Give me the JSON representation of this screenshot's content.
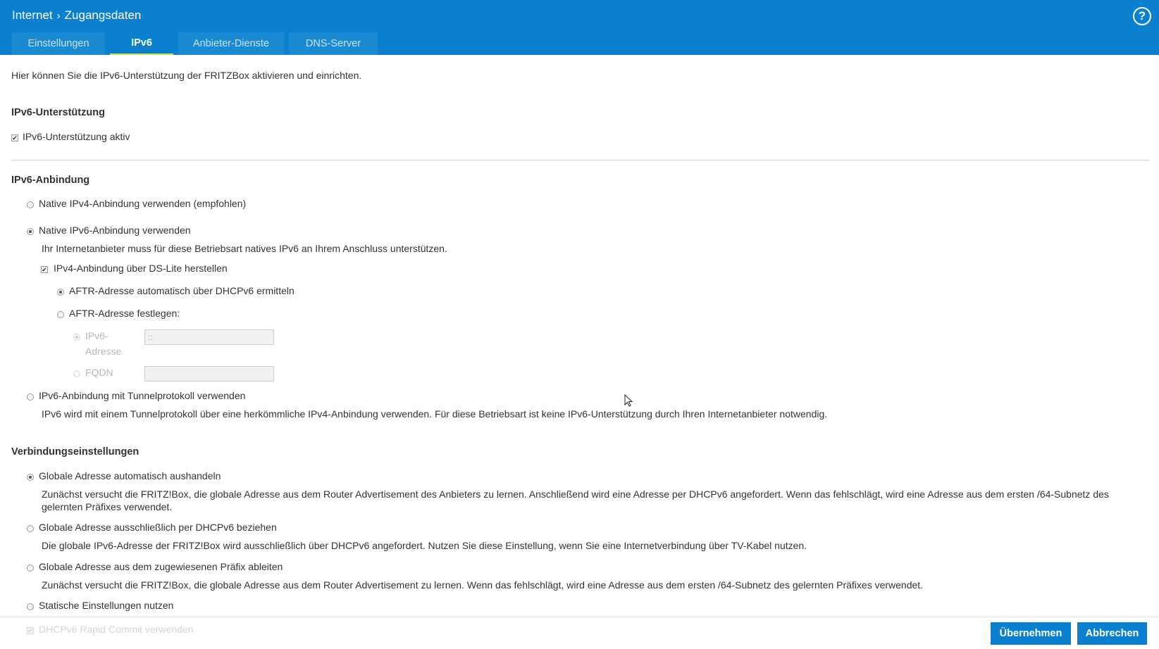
{
  "header": {
    "breadcrumb": [
      "Internet",
      "Zugangsdaten"
    ],
    "help_label": "?"
  },
  "tabs": [
    {
      "label": "Einstellungen",
      "active": false
    },
    {
      "label": "IPv6",
      "active": true
    },
    {
      "label": "Anbieter-Dienste",
      "active": false
    },
    {
      "label": "DNS-Server",
      "active": false
    }
  ],
  "intro": "Hier können Sie die IPv6-Unterstützung der FRITZBox aktivieren und einrichten.",
  "ipv6_support": {
    "heading": "IPv6-Unterstützung",
    "checkbox_label": "IPv6-Unterstützung aktiv",
    "checked": true
  },
  "binding": {
    "heading": "IPv6-Anbindung",
    "native_ipv4_label": "Native IPv4-Anbindung verwenden (empfohlen)",
    "native_ipv6_label": "Native IPv6-Anbindung verwenden",
    "native_ipv6_desc": "Ihr Internetanbieter muss für diese Betriebsart natives IPv6 an Ihrem Anschluss unterstützen.",
    "dslite_label": "IPv4-Anbindung über DS-Lite herstellen",
    "aftr_auto_label": "AFTR-Adresse automatisch über DHCPv6 ermitteln",
    "aftr_fixed_label": "AFTR-Adresse festlegen:",
    "ipv6_address_label_line1": "IPv6-",
    "ipv6_address_label_line2": "Adresse",
    "ipv6_address_value": "::",
    "fqdn_label": "FQDN",
    "fqdn_value": "",
    "tunnel_label": "IPv6-Anbindung mit Tunnelprotokoll verwenden",
    "tunnel_desc": "IPv6 wird mit einem Tunnelprotokoll über eine herkömmliche IPv4-Anbindung verwenden. Für diese Betriebsart ist keine IPv6-Unterstützung durch Ihren Internetanbieter notwendig."
  },
  "connection": {
    "heading": "Verbindungseinstellungen",
    "global_auto_label": "Globale Adresse automatisch aushandeln",
    "global_auto_desc_1": "Zunächst versucht die FRITZ!Box, die globale Adresse aus dem Router Advertisement des Anbieters zu lernen. Anschließend wird eine Adresse per DHCPv6 angefordert. Wenn das fehlschlägt, wird eine Adresse aus dem ersten /64-Subnetz des",
    "global_auto_desc_2": "gelernten Präfixes verwendet.",
    "global_dhcp_label": "Globale Adresse ausschließlich per DHCPv6 beziehen",
    "global_dhcp_desc": "Die globale IPv6-Adresse der FRITZ!Box wird ausschließlich über DHCPv6 angefordert. Nutzen Sie diese Einstellung, wenn Sie eine Internetverbindung über TV-Kabel nutzen.",
    "global_prefix_label": "Globale Adresse aus dem zugewiesenen Präfix ableiten",
    "global_prefix_desc": "Zunächst versucht die FRITZ!Box, die globale Adresse aus dem Router Advertisement zu lernen. Wenn das fehlschlägt, wird eine Adresse aus dem ersten /64-Subnetz des gelernten Präfixes verwendet.",
    "static_label": "Statische Einstellungen nutzen",
    "rapid_commit_label": "DHCPv6 Rapid Commit verwenden"
  },
  "footer": {
    "apply_label": "Übernehmen",
    "cancel_label": "Abbrechen"
  },
  "colors": {
    "header_bg": "#0a80cf",
    "tab_active_underline": "#c7e24b",
    "button_bg": "#0a80cf"
  }
}
